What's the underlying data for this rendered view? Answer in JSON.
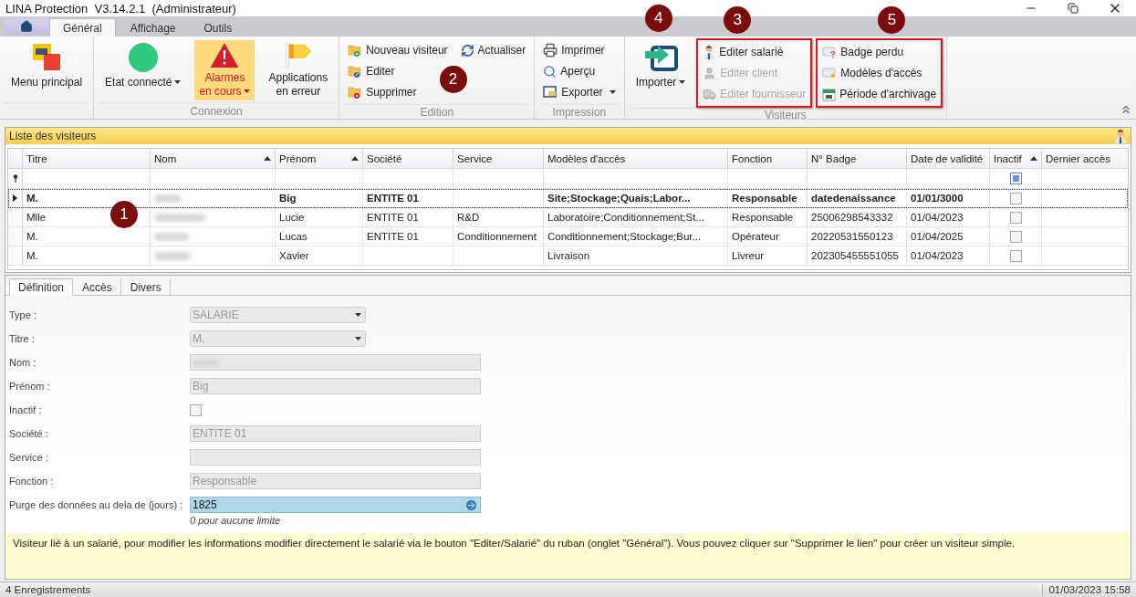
{
  "window": {
    "title": "LINA Protection  V3.14.2.1  (Administrateur)"
  },
  "ribbon_tabs": [
    {
      "label": "Général",
      "selected": true
    },
    {
      "label": "Affichage",
      "selected": false
    },
    {
      "label": "Outils",
      "selected": false
    }
  ],
  "ribbon_groups": [
    {
      "columns": [
        {
          "buttons": [
            {
              "kind": "large",
              "label": "Menu principal"
            }
          ]
        }
      ]
    },
    {
      "caption": "Connexion",
      "columns": [
        {
          "buttons": [
            {
              "kind": "large",
              "label": "Etat connecté",
              "dropdown": true
            }
          ]
        },
        {
          "buttons": [
            {
              "kind": "large",
              "label": "Alarmes\nen cours",
              "dropdown": true,
              "highlighted": true
            }
          ]
        },
        {
          "buttons": [
            {
              "kind": "large",
              "label": "Applications\nen erreur"
            }
          ]
        }
      ]
    },
    {
      "caption": "Edition",
      "columns": [
        {
          "buttons": [
            {
              "kind": "small",
              "label": "Nouveau visiteur"
            },
            {
              "kind": "small",
              "label": "Editer"
            },
            {
              "kind": "small",
              "label": "Supprimer"
            }
          ]
        },
        {
          "marker": "2",
          "buttons": [
            {
              "kind": "small",
              "label": "Actualiser"
            }
          ]
        }
      ]
    },
    {
      "caption": "Impression",
      "columns": [
        {
          "buttons": [
            {
              "kind": "small",
              "label": "Imprimer"
            },
            {
              "kind": "small",
              "label": "Aperçu"
            },
            {
              "kind": "small",
              "label": "Exporter",
              "dropdown": true
            }
          ]
        }
      ]
    },
    {
      "caption": "Visiteurs",
      "columns": [
        {
          "marker": "4",
          "buttons": [
            {
              "kind": "large",
              "label": "Importer",
              "dropdown": true
            }
          ]
        },
        {
          "outlined": true,
          "marker": "3",
          "buttons": [
            {
              "kind": "small",
              "label": "Editer salarié",
              "disabled": false
            },
            {
              "kind": "small",
              "label": "Editer client",
              "disabled": true
            },
            {
              "kind": "small",
              "label": "Editer fournisseur",
              "disabled": true
            }
          ]
        },
        {
          "outlined": true,
          "marker": "5",
          "buttons": [
            {
              "kind": "small",
              "label": "Badge perdu"
            },
            {
              "kind": "small",
              "label": "Modèles d'accès"
            },
            {
              "kind": "small",
              "label": "Période d'archivage"
            }
          ]
        }
      ]
    }
  ],
  "visitor_list": {
    "title": "Liste des visiteurs",
    "marker": "1",
    "columns": [
      {
        "label": "Titre",
        "kind": "text"
      },
      {
        "label": "Nom",
        "kind": "redacted",
        "sorted": true
      },
      {
        "label": "Prénom",
        "kind": "text",
        "sorted": true
      },
      {
        "label": "Société",
        "kind": "text"
      },
      {
        "label": "Service",
        "kind": "text"
      },
      {
        "label": "Modèles d'accès",
        "kind": "text"
      },
      {
        "label": "Fonction",
        "kind": "text"
      },
      {
        "label": "N° Badge",
        "kind": "text"
      },
      {
        "label": "Date de validité",
        "kind": "text"
      },
      {
        "label": "Inactif",
        "kind": "checkbox",
        "sorted": true,
        "filter_partial": true
      },
      {
        "label": "Dernier accès",
        "kind": "text"
      }
    ],
    "rows": [
      {
        "selected": true,
        "titre": "M.",
        "prenom": "Big",
        "societe": "ENTITE 01",
        "modeles": "Site;Stockage;Quais;Labor...",
        "fonction": "Responsable",
        "badge": "datedenaissance",
        "validite": "01/01/3000",
        "inactif": false
      },
      {
        "selected": false,
        "titre": "Mlle",
        "prenom": "Lucie",
        "societe": "ENTITE 01",
        "service": "R&D",
        "modeles": "Laboratoire;Conditionnement;St...",
        "fonction": "Responsable",
        "badge": "25006298543332",
        "validite": "01/04/2023",
        "inactif": false
      },
      {
        "selected": false,
        "titre": "M.",
        "prenom": "Lucas",
        "societe": "ENTITE 01",
        "service": "Conditionnement",
        "modeles": "Conditionnement;Stockage;Bur...",
        "fonction": "Opérateur",
        "badge": "20220531550123",
        "validite": "01/04/2025",
        "inactif": false
      },
      {
        "selected": false,
        "titre": "M.",
        "prenom": "Xavier",
        "modeles": "Livraison",
        "fonction": "Livreur",
        "badge": "202305455551055",
        "validite": "01/04/2023",
        "inactif": false
      }
    ]
  },
  "detail_tabs": [
    {
      "label": "Définition",
      "selected": true
    },
    {
      "label": "Accès",
      "selected": false
    },
    {
      "label": "Divers",
      "selected": false
    }
  ],
  "form": [
    {
      "label": "Type :",
      "kind": "select",
      "value": "SALARIE"
    },
    {
      "label": "Titre :",
      "kind": "select",
      "value": "M."
    },
    {
      "label": "Nom :",
      "kind": "text",
      "redacted": true
    },
    {
      "label": "Prénom :",
      "kind": "text",
      "value": "Big"
    },
    {
      "label": "Inactif :",
      "kind": "checkbox",
      "checked": false
    },
    {
      "label": "Société :",
      "kind": "text",
      "value": "ENTITE 01"
    },
    {
      "label": "Service :",
      "kind": "text"
    },
    {
      "label": "Fonction :",
      "kind": "text",
      "value": "Responsable"
    },
    {
      "label": "Purge des données au dela de (jours) :",
      "kind": "spin",
      "value": "1825",
      "hint": "0 pour aucune limite"
    }
  ],
  "note": "Visiteur lié à un salarié, pour modifier les informations modifier directement le salarié via le bouton \"Editer/Salarié\" du ruban (onglet \"Général\"). Vous pouvez cliquer sur \"Supprimer le lien\" pour créer un visiteur simple.",
  "status_bar": {
    "count": "4 Enregistrements",
    "datetime": "01/03/2023 15:58"
  }
}
